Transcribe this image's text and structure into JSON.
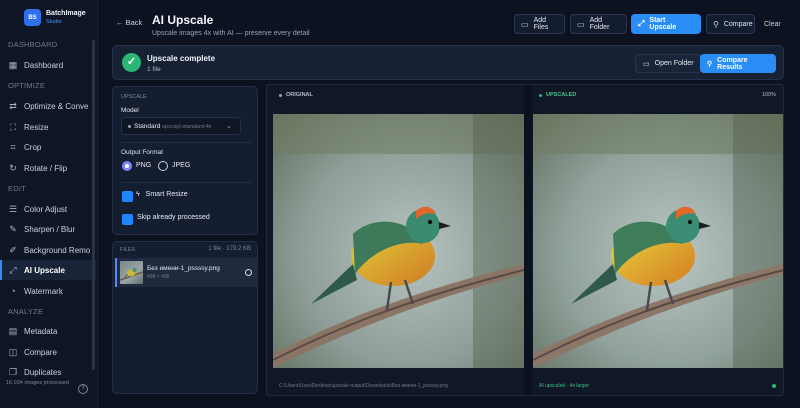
{
  "app": {
    "logo_text": "BS",
    "name": "BatchImage",
    "subtitle": "Studio"
  },
  "sidebar": {
    "sections": [
      {
        "label": "DASHBOARD"
      },
      {
        "label": "OPTIMIZE"
      },
      {
        "label": "EDIT"
      },
      {
        "label": "ANALYZE"
      }
    ],
    "items": [
      {
        "label": "Dashboard",
        "icon": "grid-icon"
      },
      {
        "label": "Optimize & Conve",
        "icon": "arrows-icon"
      },
      {
        "label": "Resize",
        "icon": "resize-icon"
      },
      {
        "label": "Crop",
        "icon": "crop-icon"
      },
      {
        "label": "Rotate / Flip",
        "icon": "rotate-icon"
      },
      {
        "label": "Color Adjust",
        "icon": "sliders-icon"
      },
      {
        "label": "Sharpen / Blur",
        "icon": "pen-icon"
      },
      {
        "label": "Background Remo",
        "icon": "eraser-icon"
      },
      {
        "label": "AI Upscale",
        "icon": "upscale-icon"
      },
      {
        "label": "Watermark",
        "icon": "drop-icon"
      },
      {
        "label": "Metadata",
        "icon": "file-icon"
      },
      {
        "label": "Compare",
        "icon": "compare-icon"
      },
      {
        "label": "Duplicates",
        "icon": "duplicates-icon"
      }
    ],
    "active_item": "AI Upscale",
    "footer_text": "16,034 images processed",
    "help_label": "?"
  },
  "header": {
    "back_label": "Back",
    "title": "AI Upscale",
    "subtitle": "Upscale images 4x with AI — preserve every detail",
    "buttons": {
      "add_files": "Add Files",
      "add_folder": "Add Folder",
      "start_upscale": "Start Upscale",
      "compare": "Compare",
      "clear": "Clear"
    }
  },
  "banner": {
    "title": "Upscale complete",
    "subtitle": "1 file",
    "open_folder": "Open Folder",
    "compare_results": "Compare Results"
  },
  "settings": {
    "section_label": "UPSCALE",
    "model_label": "Model",
    "model_value": "Standard",
    "model_hint": "upscayl-standard-4x",
    "output_label": "Output Format",
    "formats": [
      "PNG",
      "JPEG"
    ],
    "selected_format": "PNG",
    "smart_resize_label": "Smart Resize",
    "smart_resize_checked": true,
    "skip_label": "Skip already processed",
    "skip_checked": true
  },
  "files": {
    "header": "FILES",
    "count_text": "1 file · 179.2 KB",
    "items": [
      {
        "name": "Без имени-1_pssssy.png",
        "dims": "498 × 498"
      }
    ]
  },
  "compare": {
    "original_label": "ORIGINAL",
    "upscaled_label": "UPSCALED",
    "zoom": "100%",
    "original_path": "C:\\Users\\User\\Desktop\\upscale-output\\Downloads\\Без имени-1_pssssy.png",
    "upscaled_status": "AI upscaled · 4x larger"
  },
  "colors": {
    "accent": "#2a8df5",
    "success": "#2bb673",
    "background": "#0c1220"
  }
}
